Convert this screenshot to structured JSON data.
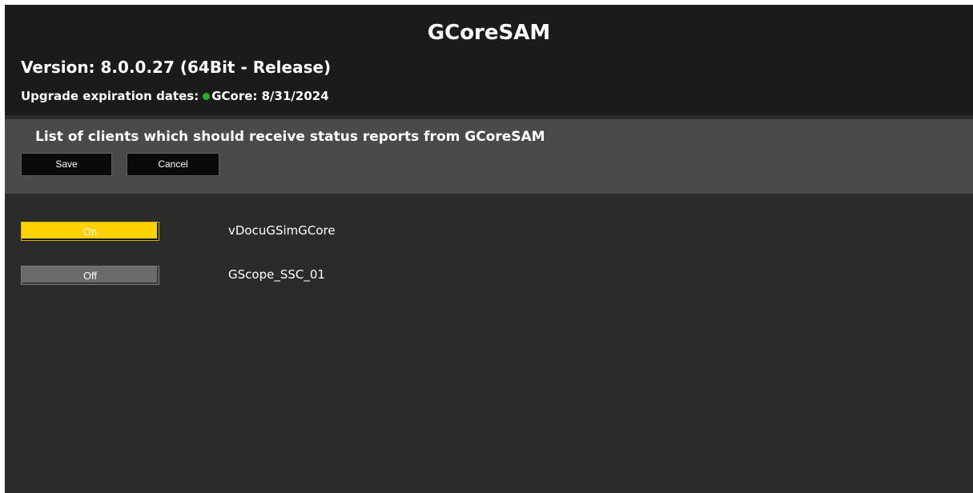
{
  "header": {
    "title": "GCoreSAM",
    "version": "Version: 8.0.0.27 (64Bit - Release)",
    "expiry_label": "Upgrade expiration dates:",
    "expiry_value": "GCore: 8/31/2024",
    "status_color": "#1db32a"
  },
  "panel": {
    "title": "List of clients which should receive status reports from GCoreSAM",
    "save_label": "Save",
    "cancel_label": "Cancel"
  },
  "clients": [
    {
      "toggle": "On",
      "name": "vDocuGSimGCore",
      "state": "on"
    },
    {
      "toggle": "Off",
      "name": "GScope_SSC_01",
      "state": "off"
    }
  ],
  "colors": {
    "on": "#ffd200",
    "off": "#6a6a6a",
    "background": "#2b2b2b",
    "header": "#1b1b1b"
  }
}
